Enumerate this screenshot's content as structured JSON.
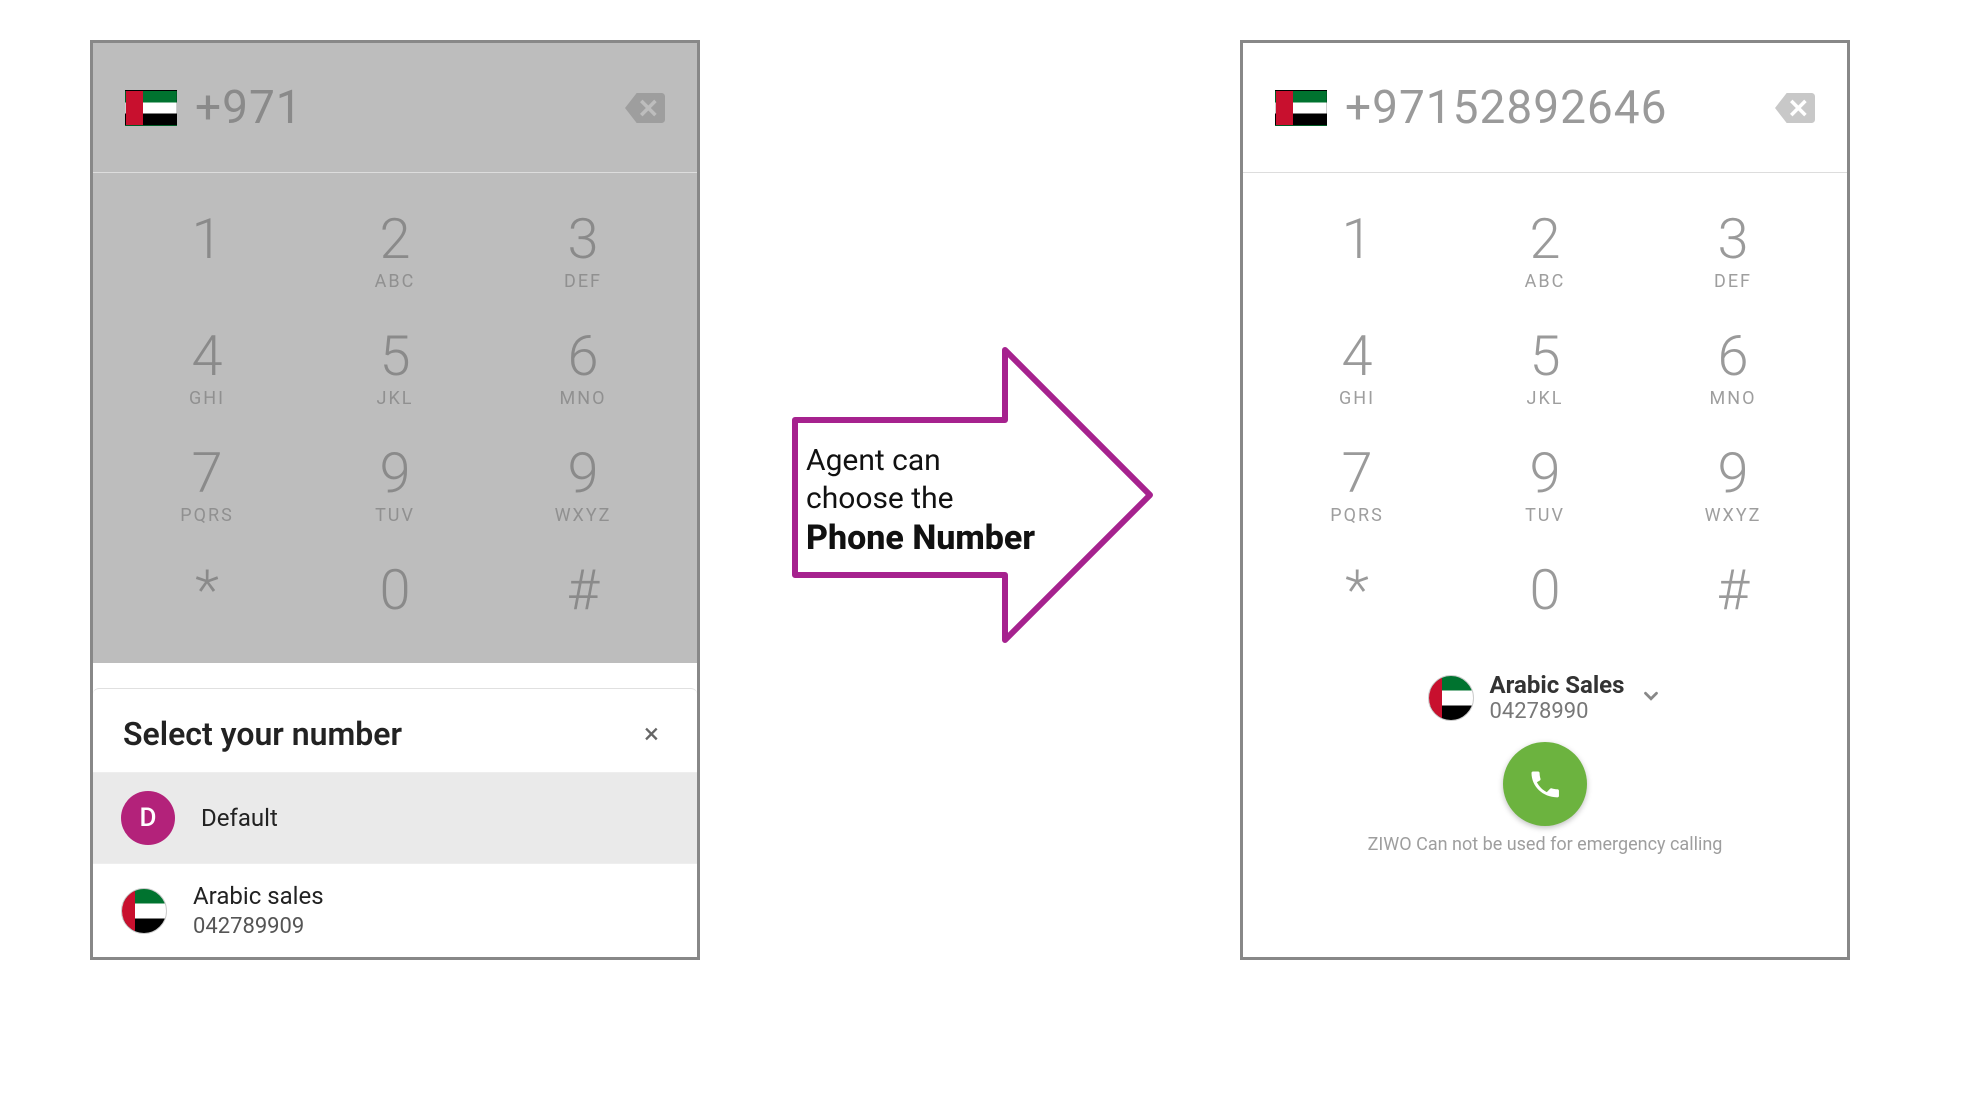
{
  "left": {
    "phone_number": "+971",
    "keypad": [
      {
        "d": "1",
        "l": ""
      },
      {
        "d": "2",
        "l": "ABC"
      },
      {
        "d": "3",
        "l": "DEF"
      },
      {
        "d": "4",
        "l": "GHI"
      },
      {
        "d": "5",
        "l": "JKL"
      },
      {
        "d": "6",
        "l": "MNO"
      },
      {
        "d": "7",
        "l": "PQRS"
      },
      {
        "d": "9",
        "l": "TUV"
      },
      {
        "d": "9",
        "l": "WXYZ"
      },
      {
        "d": "*",
        "l": ""
      },
      {
        "d": "0",
        "l": ""
      },
      {
        "d": "#",
        "l": ""
      }
    ],
    "sheet": {
      "title": "Select your number",
      "close": "×",
      "options": [
        {
          "kind": "default",
          "avatar_letter": "D",
          "label": "Default",
          "subnum": "",
          "selected": true
        },
        {
          "kind": "flag",
          "label": "Arabic sales",
          "subnum": "042789909",
          "selected": false
        }
      ]
    }
  },
  "arrow": {
    "line1": "Agent can",
    "line2": "choose the",
    "bold": "Phone Number"
  },
  "right": {
    "phone_number": "+97152892646",
    "keypad": [
      {
        "d": "1",
        "l": ""
      },
      {
        "d": "2",
        "l": "ABC"
      },
      {
        "d": "3",
        "l": "DEF"
      },
      {
        "d": "4",
        "l": "GHI"
      },
      {
        "d": "5",
        "l": "JKL"
      },
      {
        "d": "6",
        "l": "MNO"
      },
      {
        "d": "7",
        "l": "PQRS"
      },
      {
        "d": "9",
        "l": "TUV"
      },
      {
        "d": "9",
        "l": "WXYZ"
      },
      {
        "d": "*",
        "l": ""
      },
      {
        "d": "0",
        "l": ""
      },
      {
        "d": "#",
        "l": ""
      }
    ],
    "caller": {
      "name": "Arabic Sales",
      "number": "04278990"
    },
    "disclaimer": "ZIWO Can not be used for emergency calling"
  },
  "colors": {
    "arrow_border": "#a6228e",
    "call_green": "#6cb33f",
    "avatar_pink": "#b3227a"
  }
}
